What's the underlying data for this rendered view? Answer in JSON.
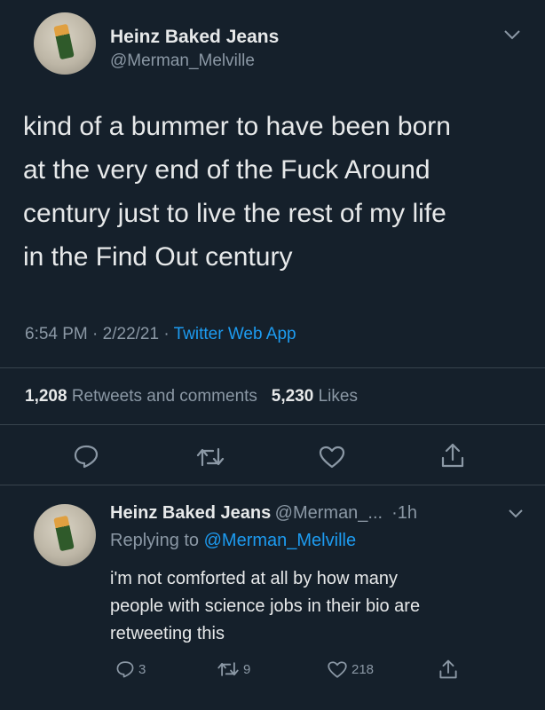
{
  "tweet": {
    "author_name": "Heinz Baked Jeans",
    "author_handle": "@Merman_Melville",
    "text_lines": [
      "kind of a bummer to have been born",
      "at the very end of the Fuck Around",
      "century just to live the rest of my life",
      "in the Find Out century"
    ],
    "time": "6:54 PM",
    "date": "2/22/21",
    "source": "Twitter Web App",
    "retweets_count": "1,208",
    "retweets_label": "Retweets and comments",
    "likes_count": "5,230",
    "likes_label": "Likes"
  },
  "reply": {
    "author_name": "Heinz Baked Jeans",
    "author_handle": "@Merman_...",
    "time_ago": "1h",
    "replying_label": "Replying to",
    "replying_handle": "@Merman_Melville",
    "text_lines": [
      "i'm not comforted at all by how many",
      "people with science jobs in their bio are",
      "retweeting this"
    ],
    "reply_count": "3",
    "retweet_count": "9",
    "like_count": "218"
  },
  "icons": {
    "reply": "comment-icon",
    "retweet": "retweet-icon",
    "like": "heart-icon",
    "share": "share-icon",
    "more": "chevron-down-icon"
  },
  "colors": {
    "background": "#15202b",
    "text": "#e7e9ea",
    "secondary": "#8b98a5",
    "accent": "#1d9bf0"
  }
}
